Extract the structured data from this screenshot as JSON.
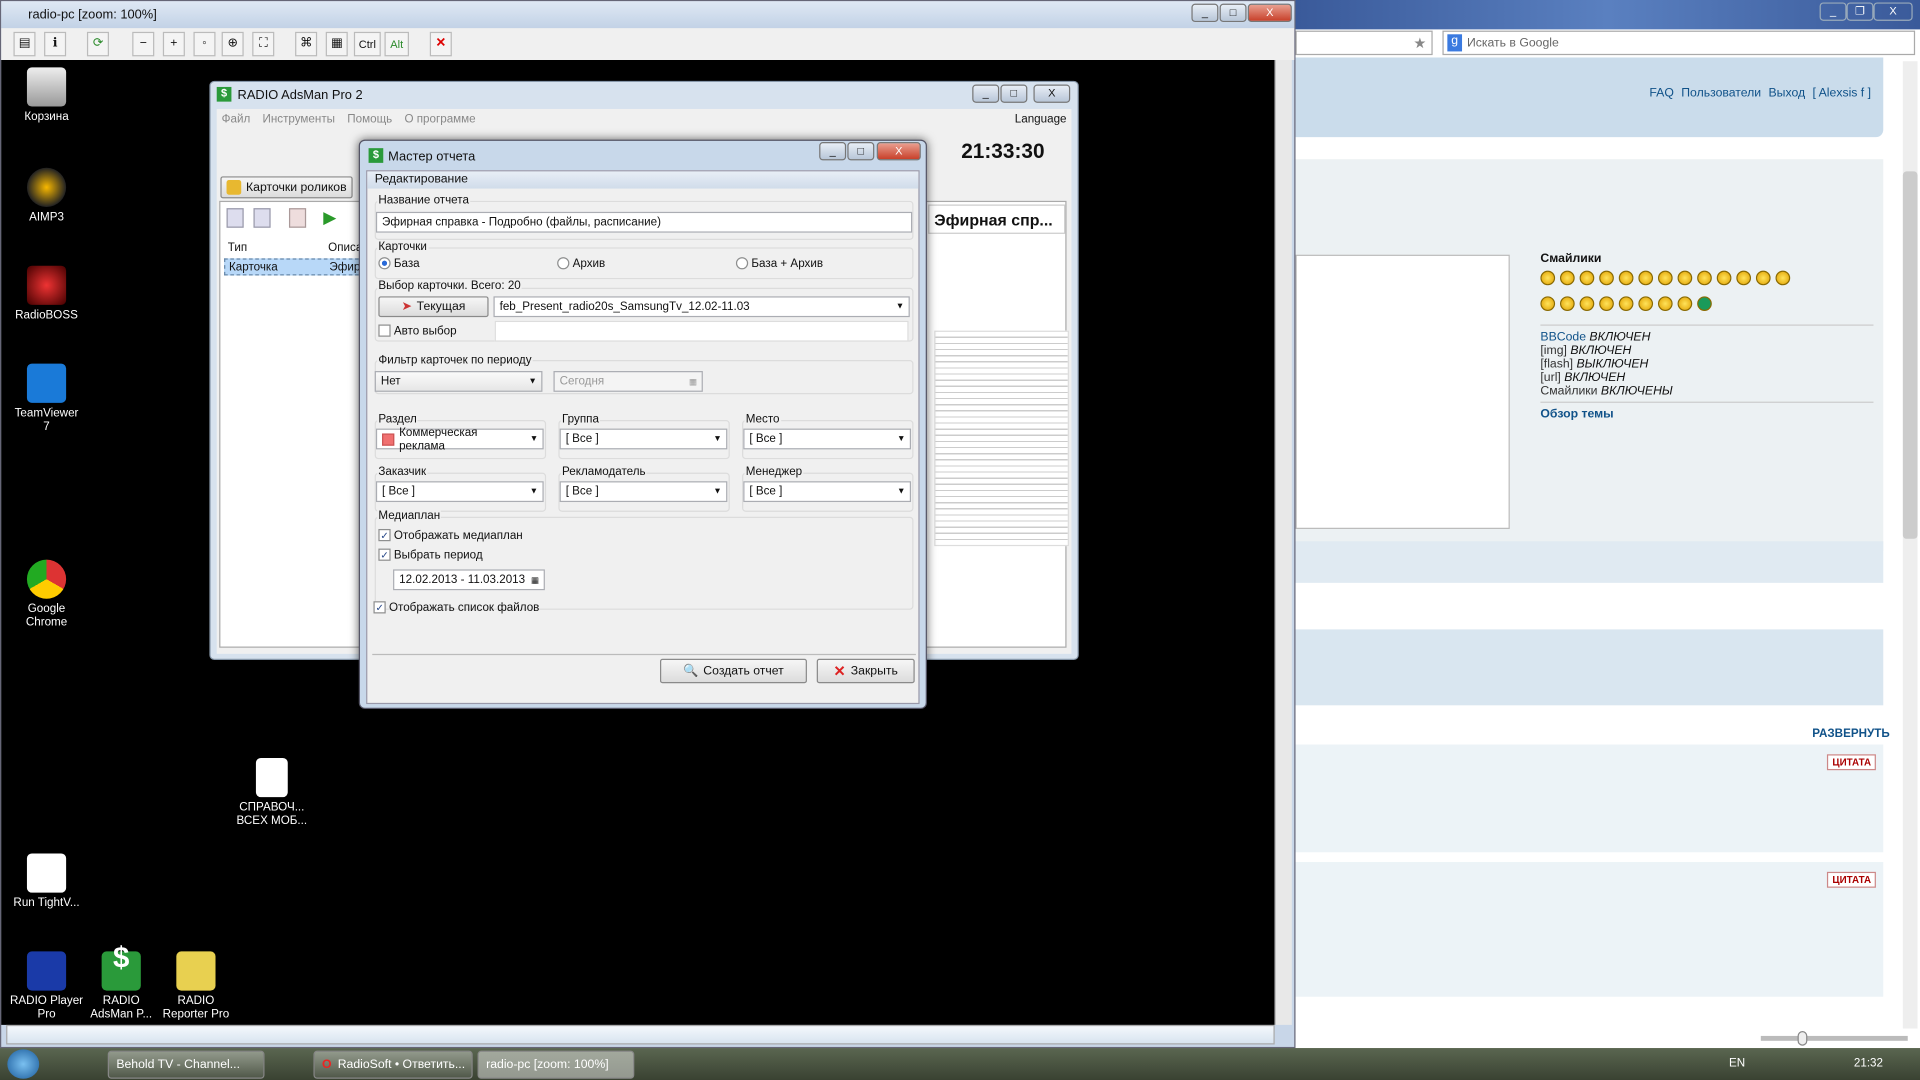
{
  "viewer": {
    "title": "radio-pc [zoom: 100%]",
    "toolbar": [
      "Ctrl",
      "Alt"
    ]
  },
  "desktop": {
    "icons": [
      {
        "label": "Корзина"
      },
      {
        "label": "AIMP3"
      },
      {
        "label": "RadioBOSS"
      },
      {
        "label": "TeamViewer 7"
      },
      {
        "label": "Google Chrome"
      },
      {
        "label": "СПРАВОЧ... ВСЕХ МОБ..."
      },
      {
        "label": "Run TightV..."
      },
      {
        "label": "RADIO Player Pro"
      },
      {
        "label": "RADIO AdsMan P..."
      },
      {
        "label": "RADIO Reporter Pro"
      }
    ]
  },
  "app": {
    "title": "RADIO AdsMan Pro 2",
    "menu": [
      "Файл",
      "Инструменты",
      "Помощь",
      "О программе"
    ],
    "language": "Language",
    "clock": "21:33:30",
    "tab": "Карточки роликов",
    "columns": [
      "Тип",
      "Описа"
    ],
    "row": [
      "Карточка",
      "Эфирн"
    ],
    "preview_title": "Эфирная спр..."
  },
  "dialog": {
    "title": "Мастер отчета",
    "section": "Редактирование",
    "report_name_label": "Название отчета",
    "report_name": "Эфирная справка - Подробно (файлы, расписание)",
    "cards_label": "Карточки",
    "radios": [
      {
        "label": "База",
        "checked": true
      },
      {
        "label": "Архив",
        "checked": false
      },
      {
        "label": "База + Архив",
        "checked": false
      }
    ],
    "card_select_label": "Выбор карточки. Всего: 20",
    "current_button": "Текущая",
    "card_value": "feb_Present_radio20s_SamsungTv_12.02-11.03",
    "auto_select": "Авто выбор",
    "auto_select_checked": false,
    "period_filter_label": "Фильтр карточек по периоду",
    "period_filter_value": "Нет",
    "period_date_placeholder": "Сегодня",
    "filters": [
      {
        "label": "Раздел",
        "value": "Коммерческая реклама",
        "color": "#f07070"
      },
      {
        "label": "Группа",
        "value": "[ Все ]"
      },
      {
        "label": "Место",
        "value": "[ Все ]"
      },
      {
        "label": "Заказчик",
        "value": "[ Все ]"
      },
      {
        "label": "Рекламодатель",
        "value": "[ Все ]"
      },
      {
        "label": "Менеджер",
        "value": "[ Все ]"
      }
    ],
    "mediaplan_label": "Медиаплан",
    "show_mediaplan": "Отображать медиаплан",
    "select_period": "Выбрать период",
    "period_value": "12.02.2013 - 11.03.2013",
    "show_files": "Отображать список файлов",
    "create_button": "Создать отчет",
    "close_button": "Закрыть"
  },
  "browser": {
    "search_placeholder": "Искать в Google",
    "nav": {
      "faq": "FAQ",
      "users": "Пользователи",
      "logout": "Выход",
      "user": "[ Alexsis f ]"
    },
    "smilies_title": "Смайлики",
    "bbcode": [
      {
        "k": "BBCode",
        "v": "ВКЛЮЧЕН"
      },
      {
        "k": "[img]",
        "v": "ВКЛЮЧЕН"
      },
      {
        "k": "[flash]",
        "v": "ВЫКЛЮЧЕН"
      },
      {
        "k": "[url]",
        "v": "ВКЛЮЧЕН"
      },
      {
        "k": "Смайлики",
        "v": "ВКЛЮЧЕНЫ"
      }
    ],
    "topic_review": "Обзор темы",
    "expand": "РАЗВЕРНУТЬ",
    "quote": "ЦИТАТА"
  },
  "taskbar": {
    "items": [
      "Behold TV - Channel...",
      "RadioSoft • Ответить...",
      "radio-pc [zoom: 100%]"
    ],
    "lang": "EN",
    "time": "21:32"
  }
}
